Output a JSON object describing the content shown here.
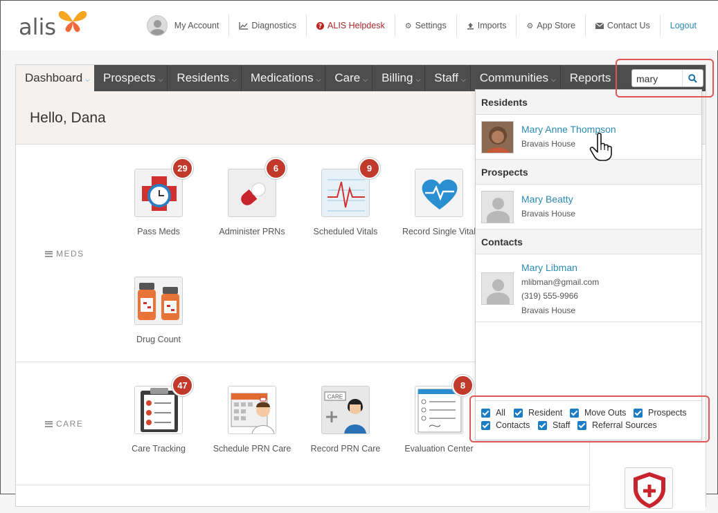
{
  "brand": {
    "name": "alis"
  },
  "top_links": [
    {
      "label": "My Account",
      "icon": "avatar"
    },
    {
      "label": "Diagnostics",
      "icon": "chart-icon"
    },
    {
      "label": "ALIS Helpdesk",
      "icon": "question-circle-icon"
    },
    {
      "label": "Settings",
      "icon": "gear-icon"
    },
    {
      "label": "Imports",
      "icon": "upload-icon"
    },
    {
      "label": "App Store",
      "icon": "gears-icon"
    },
    {
      "label": "Contact Us",
      "icon": "envelope-icon"
    },
    {
      "label": "Logout",
      "icon": ""
    }
  ],
  "nav": [
    {
      "label": "Dashboard",
      "active": true
    },
    {
      "label": "Prospects"
    },
    {
      "label": "Residents"
    },
    {
      "label": "Medications"
    },
    {
      "label": "Care"
    },
    {
      "label": "Billing"
    },
    {
      "label": "Staff"
    },
    {
      "label": "Communities"
    },
    {
      "label": "Reports"
    }
  ],
  "search": {
    "value": "mary"
  },
  "greeting": "Hello, Dana",
  "sections": {
    "meds": {
      "label": "MEDS",
      "tiles": [
        {
          "label": "Pass Meds",
          "badge": "29"
        },
        {
          "label": "Administer PRNs",
          "badge": "6"
        },
        {
          "label": "Scheduled Vitals",
          "badge": "9"
        },
        {
          "label": "Record Single Vital",
          "badge": ""
        },
        {
          "label": "Drug Count",
          "badge": ""
        }
      ]
    },
    "care": {
      "label": "CARE",
      "tiles": [
        {
          "label": "Care Tracking",
          "badge": "47"
        },
        {
          "label": "Schedule PRN Care",
          "badge": ""
        },
        {
          "label": "Record PRN Care",
          "badge": ""
        },
        {
          "label": "Evaluation Center",
          "badge": "8"
        }
      ]
    }
  },
  "search_results": {
    "residents": {
      "heading": "Residents",
      "items": [
        {
          "name": "Mary Anne Thompson",
          "community": "Bravais House"
        }
      ]
    },
    "prospects": {
      "heading": "Prospects",
      "items": [
        {
          "name": "Mary Beatty",
          "community": "Bravais House"
        }
      ]
    },
    "contacts": {
      "heading": "Contacts",
      "items": [
        {
          "name": "Mary Libman",
          "email": "mlibman@gmail.com",
          "phone": "(319) 555-9966",
          "community": "Bravais House"
        }
      ]
    }
  },
  "filters": [
    {
      "label": "All",
      "checked": true
    },
    {
      "label": "Resident",
      "checked": true
    },
    {
      "label": "Move Outs",
      "checked": true
    },
    {
      "label": "Prospects",
      "checked": true
    },
    {
      "label": "Contacts",
      "checked": true
    },
    {
      "label": "Staff",
      "checked": true
    },
    {
      "label": "Referral Sources",
      "checked": true
    }
  ],
  "colors": {
    "nav_bg": "#4d4d4d",
    "link_blue": "#2a8ab4",
    "badge_red": "#c0392b",
    "highlight_outline": "#e05656",
    "checkbox_blue": "#1c7cc4"
  }
}
